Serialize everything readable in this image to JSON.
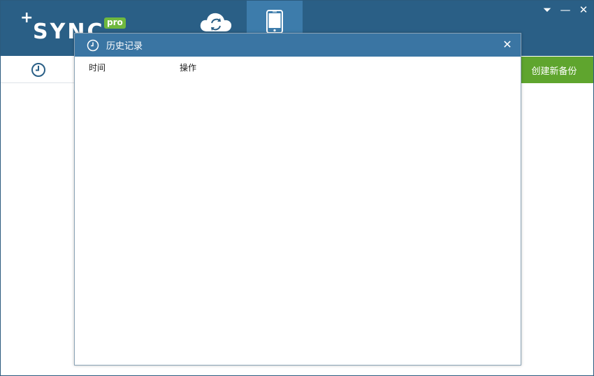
{
  "app": {
    "logo_text": "SYNC",
    "logo_plus": "+",
    "logo_badge": "pro"
  },
  "nav": {
    "tabs": [
      {
        "icon": "cloud-sync-icon",
        "active": false
      },
      {
        "icon": "phone-icon",
        "active": true
      }
    ]
  },
  "window_controls": {
    "menu": "⏷",
    "minimize": "—",
    "close": "✕"
  },
  "toolbar": {
    "history_icon": "clock-icon",
    "create_backup_label": "创建新备份"
  },
  "history_dialog": {
    "title": "历史记录",
    "close_label": "✕",
    "columns": [
      "时间",
      "操作"
    ],
    "rows": []
  },
  "colors": {
    "header_bg": "#2a5f86",
    "active_tab": "#3d7cab",
    "accent_green": "#5fa52e",
    "dialog_title_bg": "#3a75a3"
  }
}
